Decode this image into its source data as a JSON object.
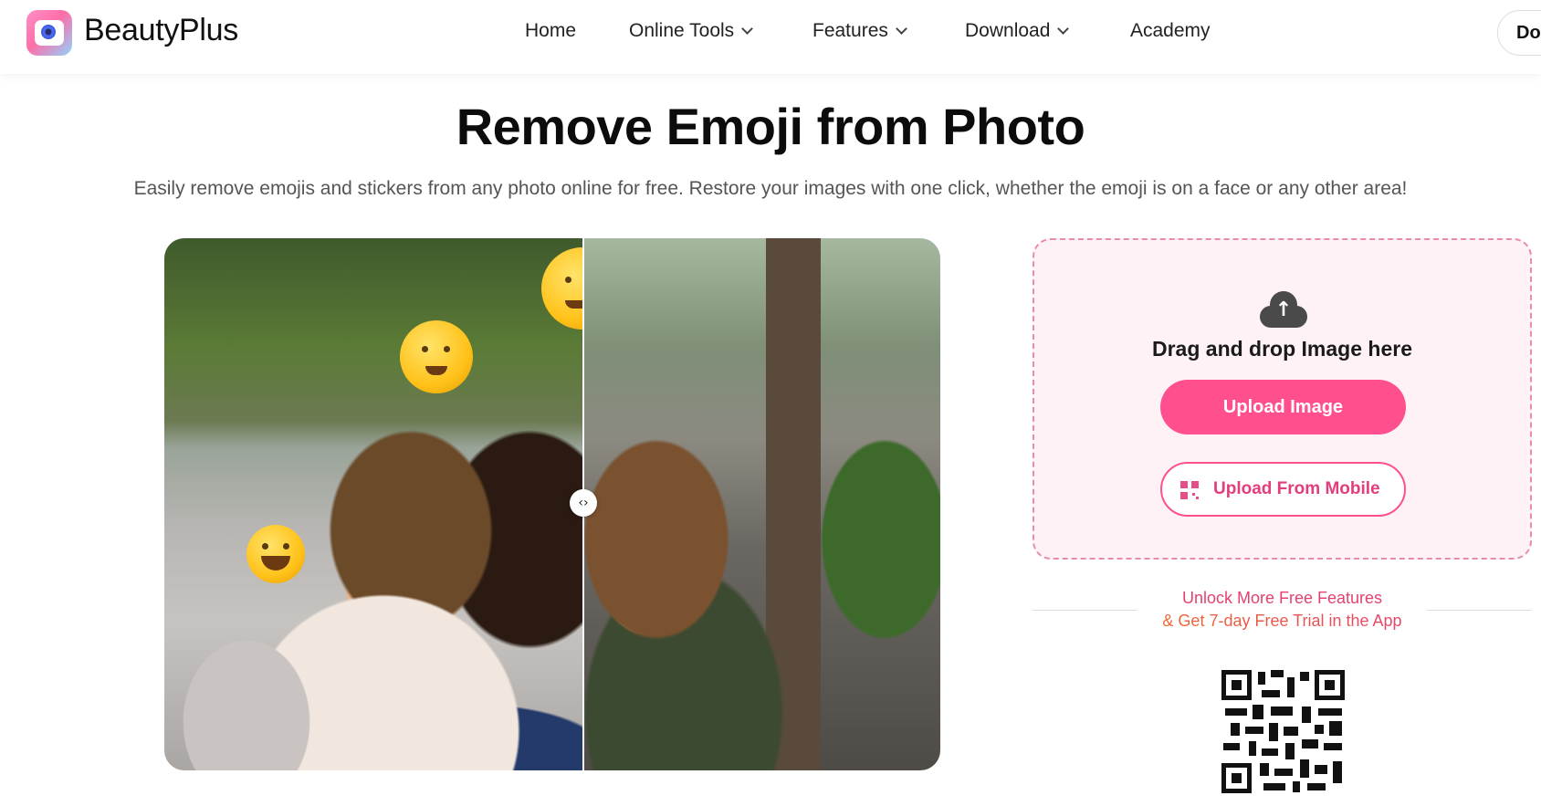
{
  "header": {
    "brand": "BeautyPlus",
    "nav": [
      {
        "label": "Home",
        "dropdown": false
      },
      {
        "label": "Online Tools",
        "dropdown": true
      },
      {
        "label": "Features",
        "dropdown": true
      },
      {
        "label": "Download",
        "dropdown": true
      },
      {
        "label": "Academy",
        "dropdown": false
      }
    ],
    "cta_label": "Do"
  },
  "hero": {
    "title": "Remove Emoji from Photo",
    "subtitle": "Easily remove emojis and stickers from any photo online for free. Restore your images with one click, whether the emoji is on a face or any other area!"
  },
  "compare": {
    "handle_icon": "left-right-arrows-icon",
    "handle_glyph": "‹›"
  },
  "upload": {
    "icon": "cloud-upload-icon",
    "drag_text": "Drag and drop Image here",
    "upload_button": "Upload Image",
    "mobile_button": "Upload From Mobile",
    "mobile_icon": "qr-code-icon"
  },
  "promo": {
    "line1": "Unlock More Free Features",
    "line2": "& Get 7-day Free Trial in the App"
  },
  "colors": {
    "accent": "#ff4f8e",
    "upload_bg": "#fff2f6",
    "dashed_border": "#e98ab0",
    "promo_orange": "#ee6b2d",
    "promo_pink": "#e6426f"
  }
}
